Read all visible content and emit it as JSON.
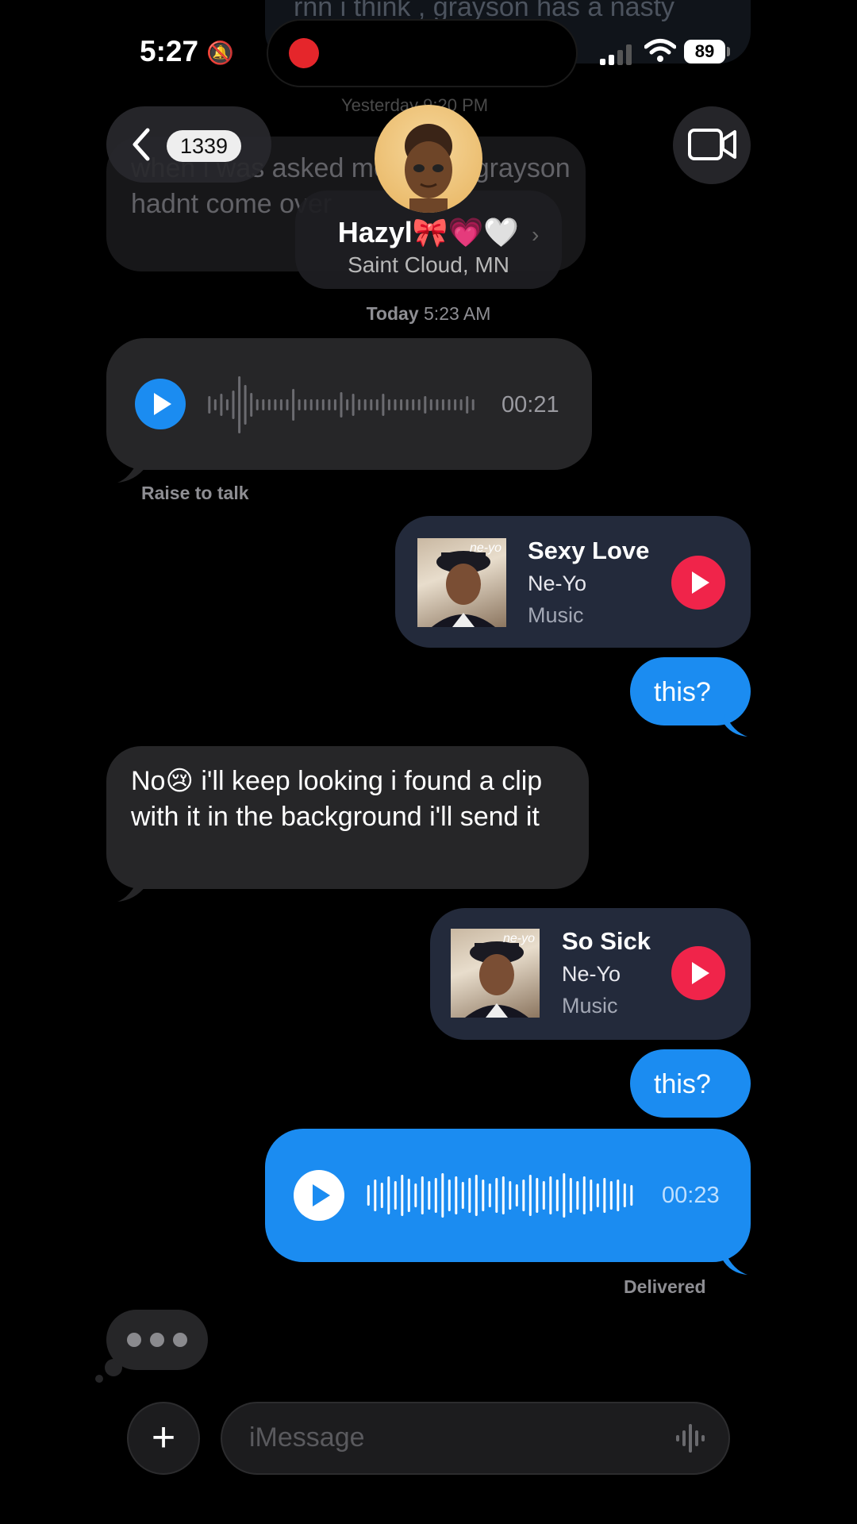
{
  "status_bar": {
    "time": "5:27",
    "battery": "89"
  },
  "background": {
    "top_partial_text": "rnn i think , grayson has a nasty",
    "ghost_timestamp": "Yesterday 9:20 PM",
    "ghost_message": "when i was asked mom why grayson hadnt come over"
  },
  "nav": {
    "back_count": "1339"
  },
  "contact": {
    "name": "Hazyl🎀💗🤍",
    "location": "Saint Cloud, MN"
  },
  "timestamp": {
    "day": "Today",
    "time": "5:23 AM"
  },
  "messages": {
    "voice_in": {
      "duration": "00:21",
      "caption": "Raise to talk"
    },
    "music_1": {
      "title": "Sexy Love",
      "artist": "Ne-Yo",
      "source": "Music",
      "album_brand": "ne-yo"
    },
    "out_1": "this?",
    "in_text": "No😢 i'll keep looking i found a clip with it in the background i'll send it",
    "music_2": {
      "title": "So Sick",
      "artist": "Ne-Yo",
      "source": "Music",
      "album_brand": "ne-yo"
    },
    "out_2": "this?",
    "voice_out": {
      "duration": "00:23"
    },
    "status": "Delivered"
  },
  "composer": {
    "placeholder": "iMessage",
    "plus": "+"
  },
  "colors": {
    "accent": "#1b8cf1",
    "incoming": "#262628",
    "music_card": "#232a3b",
    "play_red": "#f0244a"
  }
}
